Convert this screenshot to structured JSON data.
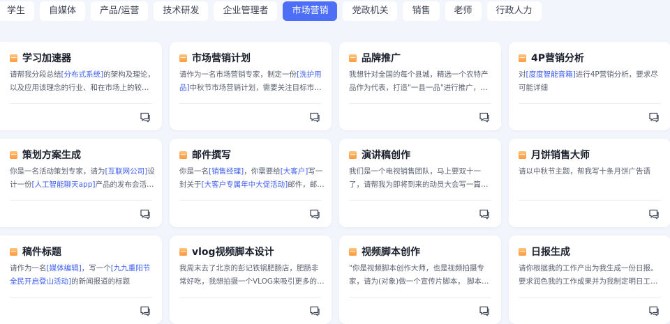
{
  "tabs": [
    {
      "label": "学生",
      "active": false
    },
    {
      "label": "自媒体",
      "active": false
    },
    {
      "label": "产品/运营",
      "active": false
    },
    {
      "label": "技术研发",
      "active": false
    },
    {
      "label": "企业管理者",
      "active": false
    },
    {
      "label": "市场营销",
      "active": true
    },
    {
      "label": "党政机关",
      "active": false
    },
    {
      "label": "销售",
      "active": false
    },
    {
      "label": "老师",
      "active": false
    },
    {
      "label": "行政人力",
      "active": false
    }
  ],
  "cards": [
    {
      "title": "学习加速器",
      "desc": [
        "请帮我分段总结",
        "[分布式系统]",
        "的架构及理论，以及应用该理念的行业、和在市场上的较常见的应用场景"
      ]
    },
    {
      "title": "市场营销计划",
      "desc": [
        "请作为一名市场营销专家，制定一份",
        "[洗护用品]",
        "中秋节市场营销计划，需要关注目标市场和推广方式"
      ]
    },
    {
      "title": "品牌推广",
      "desc": [
        "我想针对全国的每个县城，精选一个农特产品作为代表，打造\"一县一品\"进行推广，请问如何做"
      ]
    },
    {
      "title": "4P营销分析",
      "desc": [
        "对",
        "[度度智能音箱]",
        "进行4P营销分析，要求尽可能详细"
      ]
    },
    {
      "title": "策划方案生成",
      "desc": [
        "你是一名活动策划专家，请为",
        "[互联网公司]",
        "设计一份",
        "[人工智能聊天app]",
        "产品的发布会活动方案"
      ]
    },
    {
      "title": "邮件撰写",
      "desc": [
        "你是一名",
        "[销售经理]",
        "，你需要给",
        "[大客户]",
        "写一封关于",
        "[大客户专属年中大促活动]",
        "邮件，邮件内容要详细"
      ]
    },
    {
      "title": "演讲稿创作",
      "desc": [
        "我们是一个电视销售团队，马上要双十一了，请帮我为即将到来的动员大会写一篇演讲稿"
      ]
    },
    {
      "title": "月饼销售大师",
      "desc": [
        "请以中秋节主题，帮我写十条月饼广告语"
      ]
    },
    {
      "title": "稿件标题",
      "desc": [
        "请作为一名",
        "[媒体编辑]",
        "，写一个",
        "[九九重阳节全民开启登山活动]",
        "的新闻报道的标题"
      ]
    },
    {
      "title": "vlog视频脚本设计",
      "desc": [
        "我周末去了北京的彭记铁锅肥肠店，肥肠非常好吃，我想拍摄一个VLOG来吸引更多的人来这里吃"
      ]
    },
    {
      "title": "视频脚本创作",
      "desc": [
        "\"你是视频脚本创作大师，也是视频拍摄专家，请为(对象)做一个宣传片脚本， 脚本的具体要求"
      ]
    },
    {
      "title": "日报生成",
      "desc": [
        "请你根据我的工作产出为我生成一份日报。要求润色我的工作成果并为我制定明日工作计划"
      ]
    }
  ],
  "icons": {
    "title_icon": "prompt-card-icon",
    "action_icon": "chat-bubble-icon"
  },
  "colors": {
    "accent": "#4d6ef6",
    "highlight": "#3f5ff0",
    "icon_orange": "#ff9a3e"
  }
}
